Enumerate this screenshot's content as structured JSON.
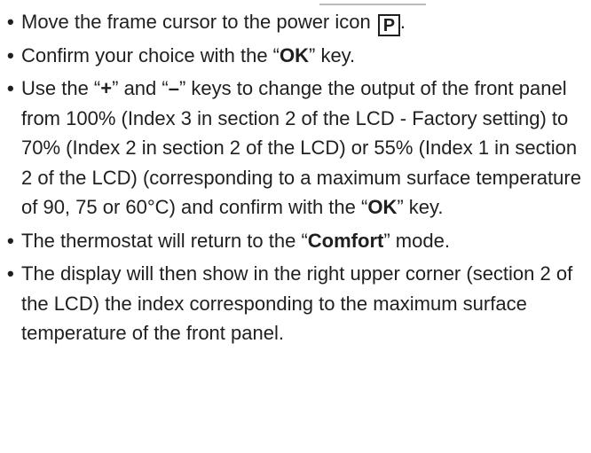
{
  "instructions": {
    "bullet_glyph": "•",
    "step1": {
      "text": "Move the frame cursor to the power icon ",
      "icon_letter": "P",
      "after": "."
    },
    "step2": {
      "pre": "Confirm your choice with the “",
      "key": "OK",
      "post": "” key."
    },
    "step3": {
      "t1": "Use the “",
      "plus": "+",
      "t2": "” and “",
      "minus": "–",
      "t3": "” keys to change the output of the front panel from 100% (Index 3 in section 2 of the LCD - Factory setting) to 70% (Index 2 in section 2 of the LCD) or 55% (Index 1 in section 2 of the LCD) (corresponding to a maximum surface temperature of 90, 75 or 60°C) and confirm with the “",
      "ok": "OK",
      "t4": "” key."
    },
    "step4": {
      "pre": "The thermostat will return to the “",
      "mode": "Comfort",
      "post": "” mode."
    },
    "step5": {
      "text": "The display will then show in the right upper corner (section 2 of the LCD) the index corresponding to the maximum surface temperature of the front panel."
    }
  }
}
